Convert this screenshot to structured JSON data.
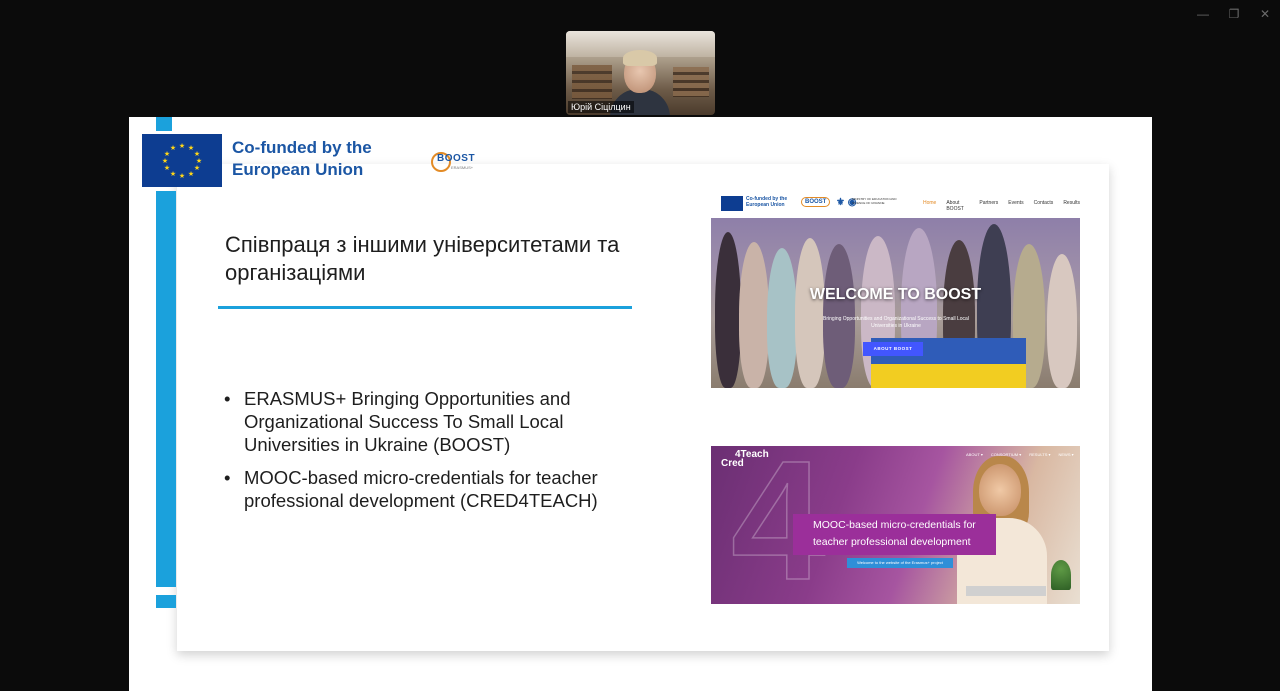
{
  "window": {
    "controls": [
      "—",
      "❐",
      "✕"
    ]
  },
  "participant": {
    "name": "Юрій Сіцілцин"
  },
  "slide": {
    "eu_logo_text": "Co-funded by the European Union",
    "boost_logo_text": "BOOST",
    "boost_logo_sub": "ERASMUS+",
    "title": "Співпраця з іншими університетами та організаціями",
    "bullets": [
      "ERASMUS+ Bringing Opportunities and Organizational Success To Small Local Universities in Ukraine (BOOST)",
      "MOOC-based micro-credentials for teacher professional development (CRED4TEACH)"
    ],
    "bullet_symbol": "•",
    "accent_color": "#1ba1dc",
    "eu_blue": "#0d3d91"
  },
  "boost_site": {
    "eu_text": "Co-funded by the European Union",
    "logo": "BOOST",
    "ministry_text": "MINISTRY OF EDUCATION AND SCIENCE OF UKRAINE",
    "menu": [
      "Home",
      "About BOOST",
      "Partners",
      "Events",
      "Contacts",
      "Results"
    ],
    "hero_title": "WELCOME TO BOOST",
    "hero_subtitle": "Bringing Opportunities and Organizational Success to Small Local Universities in Ukraine",
    "hero_button": "ABOUT BOOST"
  },
  "cred_site": {
    "logo_line1": "4Teach",
    "logo_line2": "Cred",
    "menu": [
      "ABOUT ▾",
      "CONSORTIUM ▾",
      "RESULTS ▾",
      "NEWS ▾"
    ],
    "banner_line1": "MOOC-based micro-credentials for",
    "banner_line2": "teacher professional development",
    "cta": "Welcome to the website of the Erasmus+ project"
  }
}
